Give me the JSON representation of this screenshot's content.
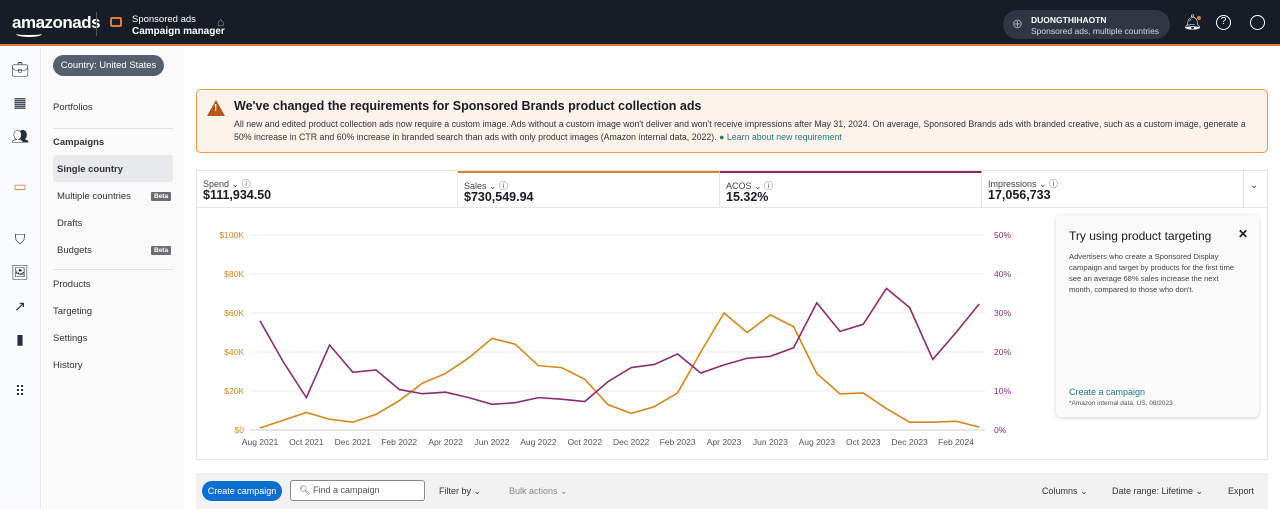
{
  "header": {
    "logo": "amazonads",
    "product": "Sponsored ads",
    "app": "Campaign manager",
    "account_name": "DUONGTHIHAOTN",
    "account_scope": "Sponsored ads, multiple countries"
  },
  "nav": {
    "country_pill": "Country: United States",
    "portfolios": "Portfolios",
    "campaigns": "Campaigns",
    "single_country": "Single country",
    "multiple_countries": "Multiple countries",
    "beta": "Beta",
    "drafts": "Drafts",
    "budgets": "Budgets",
    "products": "Products",
    "targeting": "Targeting",
    "settings": "Settings",
    "history": "History"
  },
  "alert": {
    "title": "We've changed the requirements for Sponsored Brands product collection ads",
    "body": "All new and edited product collection ads now require a custom image. Ads without a custom image won't deliver and won't receive impressions after May 31, 2024. On average, Sponsored Brands ads with branded creative, such as a custom image, generate a 50% increase in CTR and 60% increase in branded search than ads with only product images (Amazon internal data, 2022).",
    "link": "Learn about new requirement"
  },
  "metrics": [
    {
      "label": "Spend",
      "value": "$111,934.50"
    },
    {
      "label": "Sales",
      "value": "$730,549.94",
      "color": "#d4871e"
    },
    {
      "label": "ACOS",
      "value": "15.32%",
      "color": "#8a2c72"
    },
    {
      "label": "Impressions",
      "value": "17,056,733"
    }
  ],
  "promo": {
    "title": "Try using product targeting",
    "body": "Advertisers who create a Sponsored Display campaign and target by products for the first time see an average 68% sales increase the next month, compared to those who don't.",
    "link": "Create a campaign",
    "footnote": "*Amazon internal data, US, 08/2023"
  },
  "toolbar": {
    "create": "Create a campaign",
    "create_button": "Create campaign",
    "search_placeholder": "Find a campaign",
    "filter": "Filter by",
    "bulk": "Bulk actions",
    "columns": "Columns",
    "date_range": "Date range: Lifetime",
    "export": "Export"
  },
  "chart_data": {
    "type": "line",
    "grid": true,
    "x_ticks": [
      "Aug 2021",
      "Oct 2021",
      "Dec 2021",
      "Feb 2022",
      "Apr 2022",
      "Jun 2022",
      "Aug 2022",
      "Oct 2022",
      "Dec 2022",
      "Feb 2023",
      "Apr 2023",
      "Jun 2023",
      "Aug 2023",
      "Oct 2023",
      "Dec 2023",
      "Feb 2024"
    ],
    "x": [
      "2021-08",
      "2021-09",
      "2021-10",
      "2021-11",
      "2021-12",
      "2022-01",
      "2022-02",
      "2022-03",
      "2022-04",
      "2022-05",
      "2022-06",
      "2022-07",
      "2022-08",
      "2022-09",
      "2022-10",
      "2022-11",
      "2022-12",
      "2023-01",
      "2023-02",
      "2023-03",
      "2023-04",
      "2023-05",
      "2023-06",
      "2023-07",
      "2023-08",
      "2023-09",
      "2023-10",
      "2023-11",
      "2023-12",
      "2024-01",
      "2024-02",
      "2024-03"
    ],
    "left_axis": {
      "ticks": [
        "$0",
        "$20K",
        "$40K",
        "$60K",
        "$80K",
        "$100K"
      ],
      "range": [
        0,
        100000
      ],
      "color": "#d4871e"
    },
    "right_axis": {
      "ticks": [
        "0%",
        "10%",
        "20%",
        "30%",
        "40%",
        "50%"
      ],
      "range": [
        0,
        50
      ],
      "color": "#8a2c72"
    },
    "series": [
      {
        "name": "Sales",
        "axis": "left",
        "color": "#d4871e",
        "values": [
          1000,
          5000,
          9000,
          5500,
          4000,
          8000,
          15000,
          24000,
          29000,
          37000,
          47000,
          44000,
          33000,
          32000,
          26000,
          13000,
          8500,
          12000,
          19000,
          40000,
          60000,
          50000,
          59000,
          53000,
          29000,
          18500,
          19000,
          11000,
          4000,
          4000,
          4500,
          1500
        ]
      },
      {
        "name": "ACOS",
        "axis": "right",
        "color": "#8a2c72",
        "values": [
          28,
          17.5,
          8.3,
          21.8,
          14.8,
          15.4,
          10.4,
          9.3,
          9.7,
          8.3,
          6.6,
          7,
          8.3,
          7.9,
          7.3,
          12.4,
          16,
          16.8,
          19.5,
          14.6,
          16.7,
          18.4,
          18.9,
          21.1,
          32.6,
          25.3,
          27.1,
          36.3,
          31.4,
          18.1,
          25,
          32.3
        ]
      }
    ]
  }
}
